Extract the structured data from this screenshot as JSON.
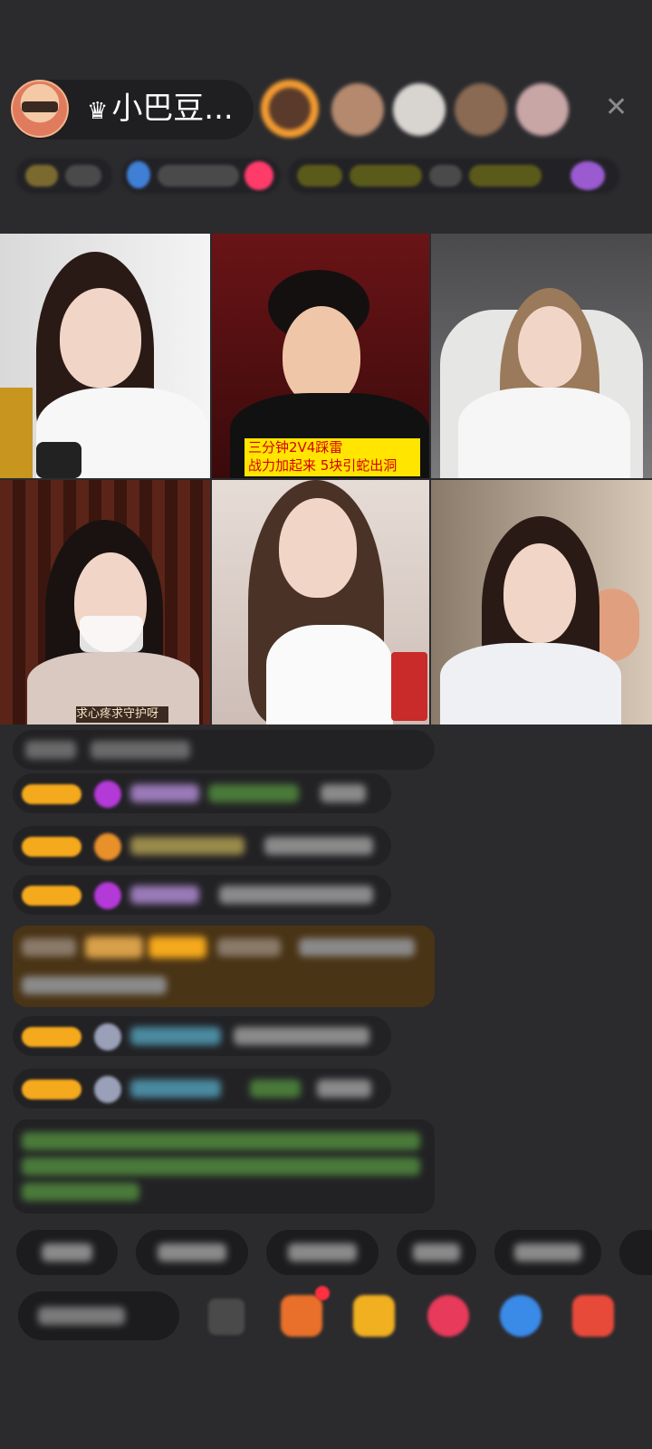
{
  "header": {
    "host_name": "小巴豆...",
    "crown_icon": "crown-icon",
    "close_icon": "close-icon"
  },
  "video_grid": {
    "caption_line1": "三分钟2V4踩雷",
    "caption_line2": "战力加起来 5块引蛇出洞",
    "caption_bottom": "求心疼求守护呀"
  },
  "colors": {
    "background": "#2b2b2e",
    "badge": "#f5a91c",
    "caption_bg": "#ffe500",
    "caption_text": "#d40000"
  }
}
